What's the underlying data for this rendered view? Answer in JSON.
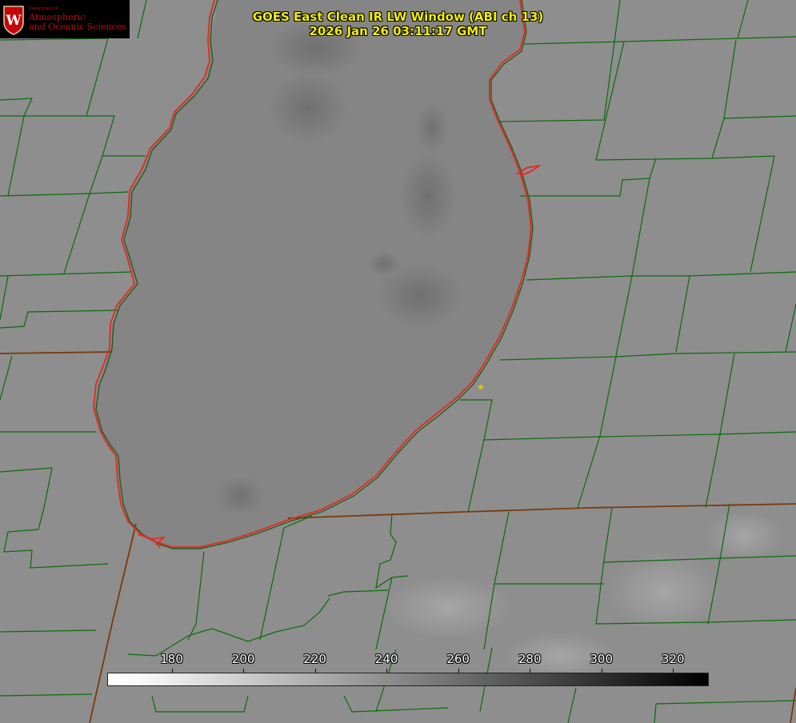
{
  "header": {
    "title_line1": "GOES East Clean IR LW Window (ABI ch 13)",
    "title_line2": "2026 Jan 26 03:11:17 GMT"
  },
  "logo": {
    "department": "Department of",
    "line1": "Atmospheric",
    "line2": "and Oceanic Sciences",
    "crest_letter": "W"
  },
  "colors": {
    "background": "#8e8e8e",
    "lake": "#858585",
    "county_lines": "#0b6b0b",
    "state_lines": "#7a3a0c",
    "lake_outline": "#e8261c",
    "title_text": "#f4f000",
    "marker": "#d4c010"
  },
  "colorbar": {
    "min": 162,
    "max": 330,
    "ticks": [
      {
        "value": 180,
        "label": "180"
      },
      {
        "value": 200,
        "label": "200"
      },
      {
        "value": 220,
        "label": "220"
      },
      {
        "value": 240,
        "label": "240"
      },
      {
        "value": 260,
        "label": "260"
      },
      {
        "value": 280,
        "label": "280"
      },
      {
        "value": 300,
        "label": "300"
      },
      {
        "value": 320,
        "label": "320"
      }
    ]
  }
}
